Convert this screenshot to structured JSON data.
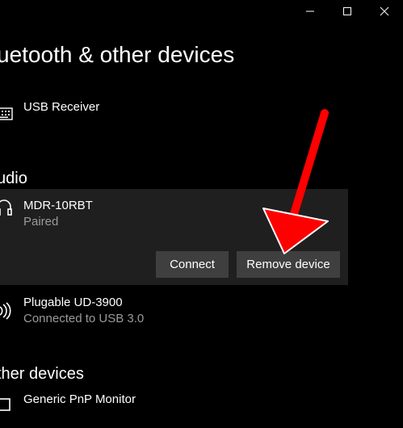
{
  "window": {
    "controls": [
      "minimize",
      "maximize",
      "close"
    ]
  },
  "page": {
    "title": "uetooth & other devices"
  },
  "sections": {
    "audio_heading": "udio",
    "other_heading": "ther devices"
  },
  "devices": {
    "usb_receiver": {
      "name": "USB Receiver",
      "icon": "keyboard-icon"
    },
    "mdr": {
      "name": "MDR-10RBT",
      "status": "Paired",
      "icon": "headphones-icon"
    },
    "plugable": {
      "name": "Plugable UD-3900",
      "status": "Connected to USB 3.0",
      "icon": "speaker-icon"
    },
    "monitor": {
      "name": "Generic PnP Monitor",
      "icon": "monitor-icon"
    }
  },
  "actions": {
    "connect": "Connect",
    "remove": "Remove device"
  },
  "colors": {
    "background": "#000000",
    "panel": "#1f1f1f",
    "button": "#3f3f3f",
    "secondary_text": "#9a9a9a",
    "arrow": "#ff0000"
  }
}
